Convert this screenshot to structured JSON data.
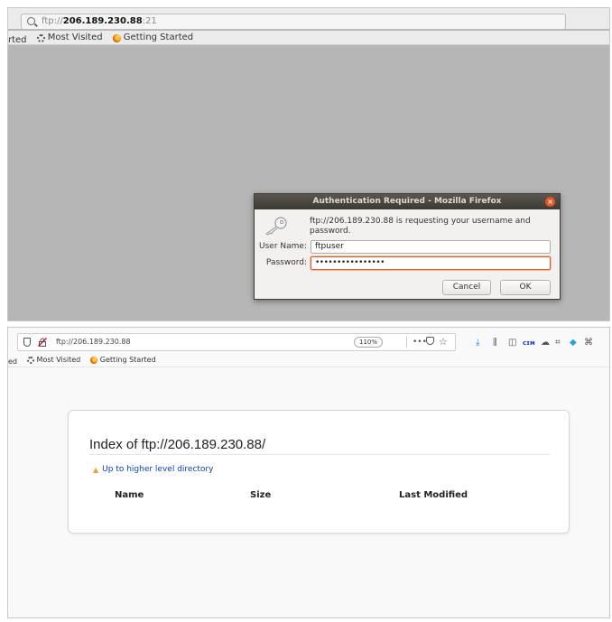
{
  "top": {
    "url_prefix": "ftp://",
    "url_host": "206.189.230.88",
    "url_port": ":21",
    "bookmarks": [
      {
        "label": "rted",
        "icon": "none"
      },
      {
        "label": "Most Visited",
        "icon": "gear-icon"
      },
      {
        "label": "Getting Started",
        "icon": "firefox-icon"
      }
    ],
    "dialog": {
      "title": "Authentication Required - Mozilla Firefox",
      "message": "ftp://206.189.230.88 is requesting your username and password.",
      "username_label": "User Name:",
      "username_value": "ftpuser",
      "password_label": "Password:",
      "password_value": "••••••••••••••••",
      "cancel_label": "Cancel",
      "ok_label": "OK",
      "close_glyph": "×",
      "accent_color": "#e95420"
    }
  },
  "bottom": {
    "url": "ftp://206.189.230.88",
    "zoom": "110%",
    "more_glyph": "•••",
    "star_glyph": "☆",
    "bookmarks": [
      {
        "label": "ed",
        "icon": "none"
      },
      {
        "label": "Most Visited",
        "icon": "gear-icon"
      },
      {
        "label": "Getting Started",
        "icon": "firefox-icon"
      }
    ],
    "toolbar_icons": [
      {
        "name": "download-icon",
        "glyph": "⤓",
        "color": "#0a84ff"
      },
      {
        "name": "library-icon",
        "glyph": "⫼",
        "color": "#555555"
      },
      {
        "name": "sidebar-icon",
        "glyph": "◫",
        "color": "#555555"
      },
      {
        "name": "extension-cim-icon",
        "glyph": "ᴄɪᴍ",
        "color": "#1a3fbf"
      },
      {
        "name": "cloud-icon",
        "glyph": "☁",
        "color": "#555555"
      },
      {
        "name": "screenshot-icon",
        "glyph": "⌗",
        "color": "#555555"
      },
      {
        "name": "extension-blue-icon",
        "glyph": "◆",
        "color": "#2aa0e0"
      },
      {
        "name": "share-icon",
        "glyph": "⌘",
        "color": "#555555"
      }
    ],
    "index": {
      "title": "Index of ftp://206.189.230.88/",
      "up_link": "Up to higher level directory",
      "columns": [
        "Name",
        "Size",
        "Last Modified"
      ]
    }
  }
}
